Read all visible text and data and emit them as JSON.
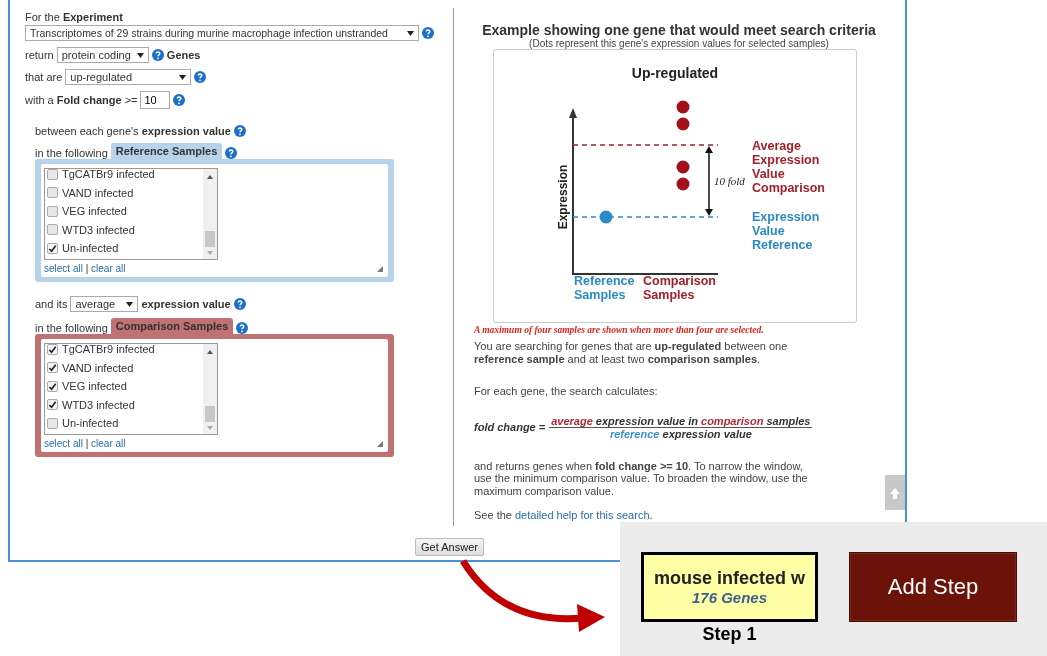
{
  "form": {
    "experiment_label": "For the **Experiment**",
    "experiment_select": "Transcriptomes of 29 strains during murine macrophage infection unstranded",
    "return_label": "return",
    "return_select": "protein coding",
    "genes_label": "Genes",
    "that_are_label": "that are",
    "direction_select": "up-regulated",
    "fold_label": "with a **Fold change** >=",
    "fold_value": "10"
  },
  "reference": {
    "intro": "between each gene's **expression value**",
    "following": "in the following",
    "tab": "Reference Samples",
    "select_all": "select all",
    "separator": "|",
    "clear_all": "clear all",
    "samples": [
      {
        "label": "TgCATBr9 infected",
        "checked": false
      },
      {
        "label": "VAND infected",
        "checked": false
      },
      {
        "label": "VEG infected",
        "checked": false
      },
      {
        "label": "WTD3 infected",
        "checked": false
      },
      {
        "label": "Un-infected",
        "checked": true
      }
    ]
  },
  "comparison": {
    "intro_prefix": "and its",
    "operation_select": "average",
    "intro_suffix": "expression value",
    "following": "in the following",
    "tab": "Comparison Samples",
    "select_all": "select all",
    "separator": "|",
    "clear_all": "clear all",
    "samples": [
      {
        "label": "TgCATBr9 infected",
        "checked": true
      },
      {
        "label": "VAND infected",
        "checked": true
      },
      {
        "label": "VEG infected",
        "checked": true
      },
      {
        "label": "WTD3 infected",
        "checked": true
      },
      {
        "label": "Un-infected",
        "checked": false
      }
    ]
  },
  "example": {
    "title": "Example showing one gene that would meet search criteria",
    "subtitle": "(Dots represent this gene's expression values for selected samples)",
    "diagram": {
      "title": "Up-regulated",
      "y_axis": "Expression",
      "fold": "10 fold",
      "comparison_legend": "Average Expression Value Comparison",
      "reference_legend": "Expression Value Reference",
      "reference_axis": "Reference Samples",
      "comparison_axis": "Comparison Samples"
    },
    "note": "A maximum of four samples are shown when more than four are selected.",
    "description": "You are searching for genes that are **up-regulated** between one **reference sample** and at least two **comparison samples**.",
    "calc_intro": "For each gene, the search calculates:",
    "formula_label": "fold change =",
    "numerator": [
      {
        "text": "average",
        "kind": "comparison"
      },
      {
        "text": " expression value in ",
        "kind": "plain"
      },
      {
        "text": "comparison",
        "kind": "comparison"
      },
      {
        "text": " samples",
        "kind": "plain"
      }
    ],
    "denominator": [
      {
        "text": "reference",
        "kind": "reference"
      },
      {
        "text": " expression value",
        "kind": "plain"
      }
    ],
    "returns": "and returns genes when **fold change** **>= 10**. To narrow the window, use the minimum comparison value. To broaden the window, use the maximum comparison value.",
    "help_prefix": "See the",
    "help_link": "detailed help for this search",
    "help_suffix": "."
  },
  "get_answer": "Get Answer",
  "step": {
    "name": "mouse infected w",
    "count": "176 Genes",
    "label": "Step 1"
  },
  "add_step": "Add Step"
}
